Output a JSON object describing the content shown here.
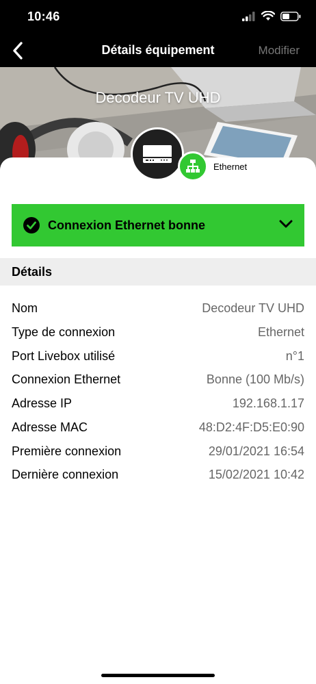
{
  "status_bar": {
    "time": "10:46"
  },
  "nav": {
    "back_icon": "chevron-left-icon",
    "title": "Détails équipement",
    "edit_label": "Modifier"
  },
  "hero": {
    "device_name": "Decodeur TV UHD",
    "device_icon": "tv-decoder-icon"
  },
  "connection_badge": {
    "icon": "ethernet-icon",
    "label": "Ethernet",
    "color": "#32c832"
  },
  "status_banner": {
    "text": "Connexion Ethernet bonne",
    "color": "#32c832",
    "icon": "check-circle-icon",
    "chevron": "chevron-down-icon"
  },
  "details": {
    "title": "Détails",
    "rows": [
      {
        "label": "Nom",
        "value": "Decodeur TV UHD"
      },
      {
        "label": "Type de connexion",
        "value": "Ethernet"
      },
      {
        "label": "Port Livebox utilisé",
        "value": "n°1"
      },
      {
        "label": "Connexion Ethernet",
        "value": "Bonne (100 Mb/s)"
      },
      {
        "label": "Adresse IP",
        "value": "192.168.1.17"
      },
      {
        "label": "Adresse MAC",
        "value": "48:D2:4F:D5:E0:90"
      },
      {
        "label": "Première connexion",
        "value": "29/01/2021 16:54"
      },
      {
        "label": "Dernière connexion",
        "value": "15/02/2021 10:42"
      }
    ]
  }
}
